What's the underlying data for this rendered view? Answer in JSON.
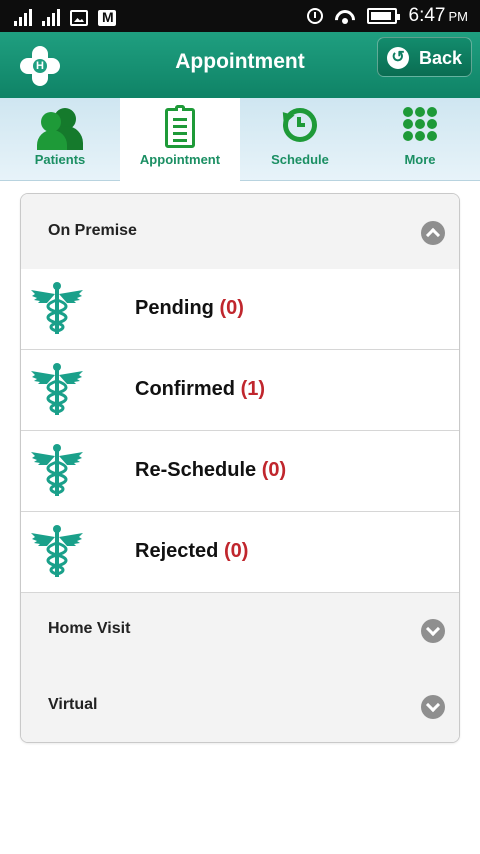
{
  "status_bar": {
    "time": "6:47",
    "ampm": "PM"
  },
  "header": {
    "title": "Appointment",
    "back_label": "Back",
    "logo_letter": "H"
  },
  "tabs": [
    {
      "label": "Patients",
      "icon": "patients-icon"
    },
    {
      "label": "Appointment",
      "icon": "clipboard-icon",
      "active": true
    },
    {
      "label": "Schedule",
      "icon": "history-clock-icon"
    },
    {
      "label": "More",
      "icon": "grid-dots-icon"
    }
  ],
  "sections": {
    "on_premise": {
      "label": "On Premise",
      "expanded": true,
      "items": [
        {
          "label": "Pending",
          "count": "(0)"
        },
        {
          "label": "Confirmed",
          "count": "(1)"
        },
        {
          "label": "Re-Schedule",
          "count": "(0)"
        },
        {
          "label": "Rejected",
          "count": "(0)"
        }
      ]
    },
    "home_visit": {
      "label": "Home Visit",
      "expanded": false
    },
    "virtual": {
      "label": "Virtual",
      "expanded": false
    }
  },
  "colors": {
    "header_green": "#148f70",
    "tab_green": "#1b8f63",
    "count_red": "#c0262d",
    "icon_teal": "#1aa08a"
  }
}
